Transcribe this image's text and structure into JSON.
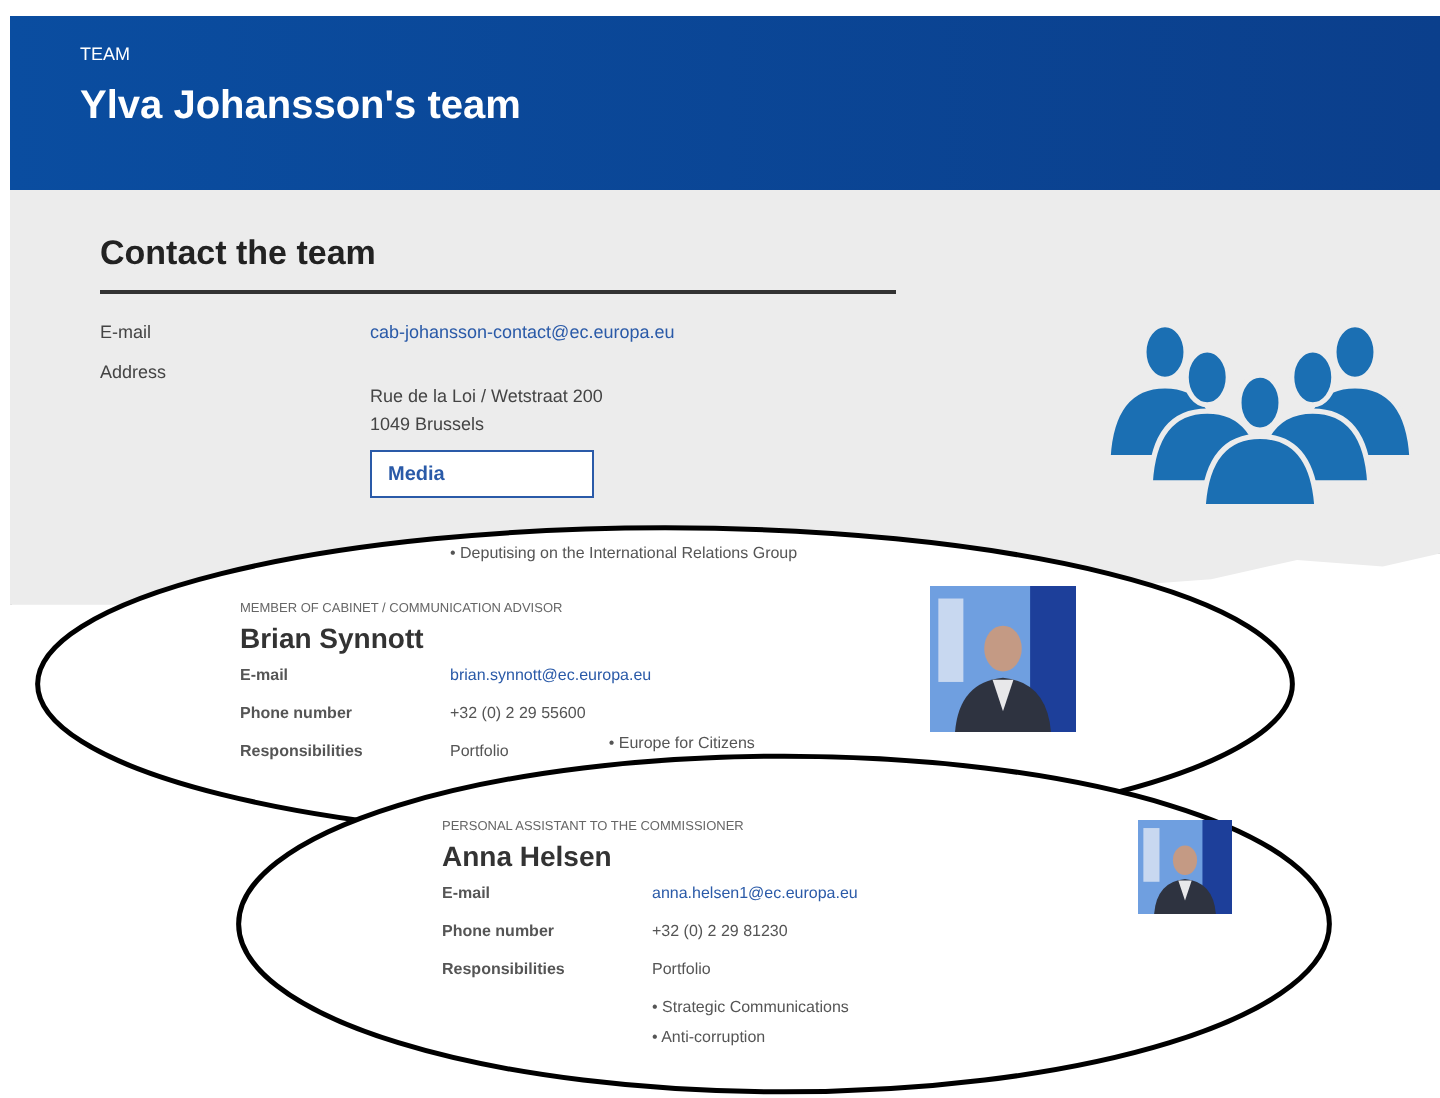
{
  "header": {
    "breadcrumb": "TEAM",
    "title": "Ylva Johansson's team"
  },
  "contact": {
    "heading": "Contact the team",
    "email_label": "E-mail",
    "email": "cab-johansson-contact@ec.europa.eu",
    "address_label": "Address",
    "address_lines": [
      "Rue de la Loi / Wetstraat 200",
      "1049 Brussels"
    ],
    "button": "Media"
  },
  "cards": [
    {
      "bullet_above": "• Deputising on the International Relations Group",
      "role": "MEMBER OF CABINET / COMMUNICATION ADVISOR",
      "name": "Brian Synnott",
      "fields": [
        {
          "label": "E-mail",
          "value": "brian.synnott@ec.europa.eu",
          "kind": "link"
        },
        {
          "label": "Phone number",
          "value": "+32 (0) 2 29 55600",
          "kind": "text"
        },
        {
          "label": "Responsibilities",
          "value": "Portfolio",
          "kind": "text",
          "side": "• Europe for Citizens"
        }
      ],
      "photo": {
        "kind": "picture"
      }
    },
    {
      "role": "PERSONAL ASSISTANT TO THE COMMISSIONER",
      "name": "Anna Helsen",
      "fields": [
        {
          "label": "E-mail",
          "value": "anna.helsen1@ec.europa.eu",
          "kind": "link"
        },
        {
          "label": "Phone number",
          "value": "+32 (0) 2 29 81230",
          "kind": "text"
        },
        {
          "label": "Responsibilities",
          "value": "Portfolio",
          "kind": "text"
        }
      ],
      "bullets": [
        "• Strategic Communications",
        "• Anti-corruption"
      ],
      "photo": {
        "kind": "picture"
      }
    }
  ]
}
